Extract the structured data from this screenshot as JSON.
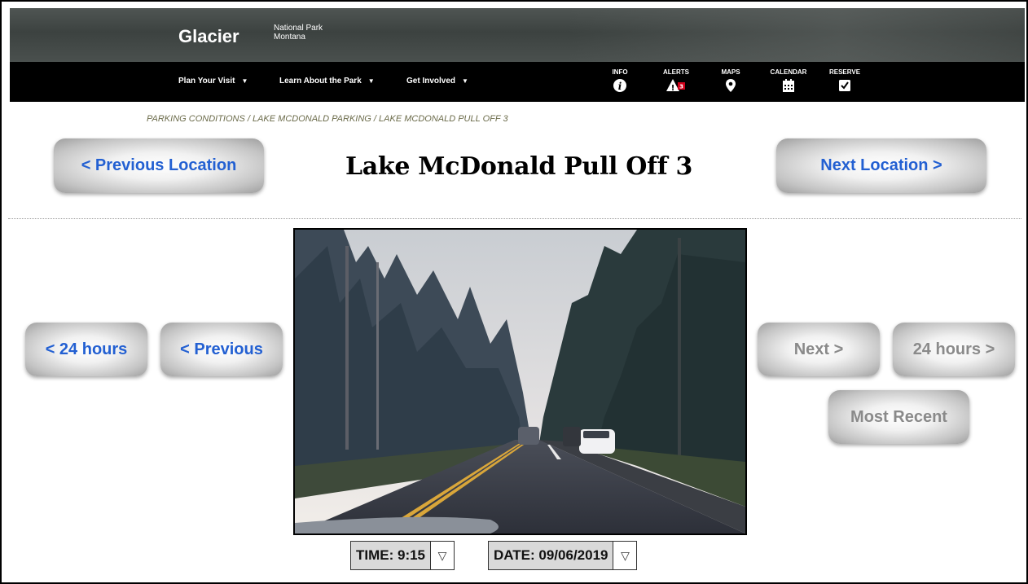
{
  "brand": {
    "name": "Glacier",
    "subtitle_line1": "National Park",
    "subtitle_line2": "Montana"
  },
  "nav": {
    "items": [
      {
        "label": "Plan Your Visit"
      },
      {
        "label": "Learn About the Park"
      },
      {
        "label": "Get Involved"
      }
    ],
    "quick_links": [
      {
        "label": "INFO",
        "icon": "info-icon"
      },
      {
        "label": "ALERTS",
        "icon": "alert-icon",
        "badge": "3"
      },
      {
        "label": "MAPS",
        "icon": "map-pin-icon"
      },
      {
        "label": "CALENDAR",
        "icon": "calendar-icon"
      },
      {
        "label": "RESERVE",
        "icon": "checkbox-icon"
      }
    ]
  },
  "breadcrumb": "PARKING CONDITIONS / LAKE MCDONALD PARKING / LAKE MCDONALD PULL OFF 3",
  "page": {
    "title": "Lake McDonald Pull Off 3",
    "prev_location": "< Previous Location",
    "next_location": "Next Location >"
  },
  "image_nav": {
    "back_24": "< 24 hours",
    "previous": "< Previous",
    "next": "Next >",
    "forward_24": "24 hours >",
    "most_recent": "Most Recent"
  },
  "selectors": {
    "time_label": "TIME: 9:15",
    "date_label": "DATE: 09/06/2019",
    "arrow": "▽"
  },
  "colors": {
    "accent_blue": "#2360d2",
    "disabled_gray": "#8a8a8a",
    "breadcrumb": "#6b6b4a"
  }
}
